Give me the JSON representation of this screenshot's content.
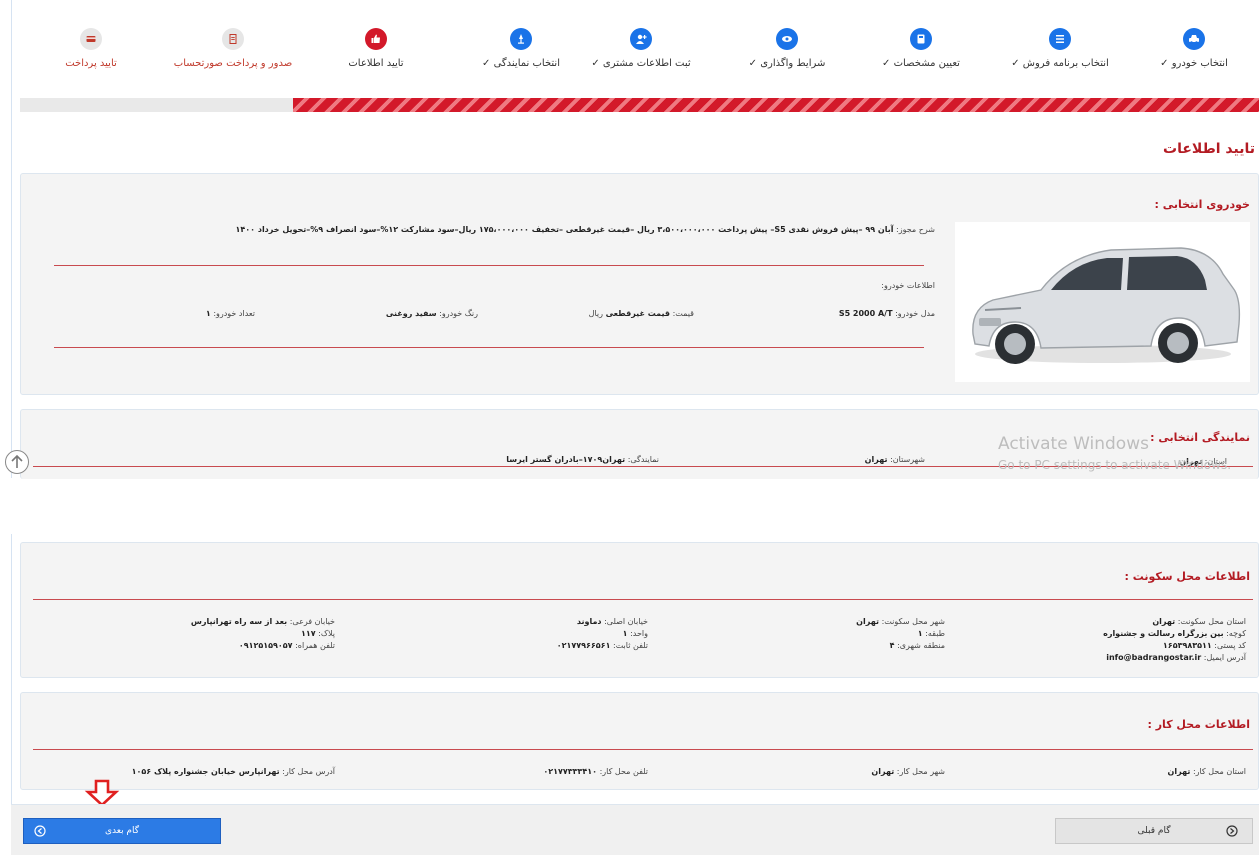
{
  "steps": [
    {
      "label": "انتخاب خودرو",
      "check": "✓",
      "state": "done",
      "icon": "car-icon"
    },
    {
      "label": "انتخاب برنامه فروش",
      "check": "✓",
      "state": "done",
      "icon": "list-icon"
    },
    {
      "label": "تعیین مشخصات",
      "check": "✓",
      "state": "done",
      "icon": "calculator-icon"
    },
    {
      "label": "شرایط واگذاری",
      "check": "✓",
      "state": "done",
      "icon": "eye-icon"
    },
    {
      "label": "ثبت اطلاعات مشتری",
      "check": "✓",
      "state": "done",
      "icon": "user-add-icon"
    },
    {
      "label": "انتخاب نمایندگی",
      "check": "✓",
      "state": "done",
      "icon": "pin-icon"
    },
    {
      "label": "تایید اطلاعات",
      "check": "",
      "state": "active",
      "icon": "thumbs-up-icon"
    },
    {
      "label": "صدور و پرداخت صورتحساب",
      "check": "",
      "state": "pending",
      "icon": "invoice-icon"
    },
    {
      "label": "تایید پرداخت",
      "check": "",
      "state": "pending",
      "icon": "card-icon"
    }
  ],
  "progress": {
    "fraction": 0.78
  },
  "page_title": "تایید اطلاعات",
  "car": {
    "title": "خودروی انتخابی :",
    "desc_label": "شرح مجوز:",
    "desc_value": "آبان ۹۹ –پیش فروش نقدی S5– پیش پرداخت ۳،۵۰۰،۰۰۰،۰۰۰ ریال –قیمت غیرقطعی –تخفیف ۱۷۵،۰۰۰،۰۰۰ ریال–سود مشارکت ۱۲%–سود انصراف ۹%–تحویل خرداد ۱۴۰۰",
    "info_label": "اطلاعات خودرو:",
    "model_label": "مدل خودرو:",
    "model_value": "S5 2000 A/T",
    "price_label": "قیمت:",
    "price_value": "قیمت غیرقطعی",
    "price_unit": "ریال",
    "color_label": "رنگ خودرو:",
    "color_value": "سفید روغنی",
    "count_label": "تعداد خودرو:",
    "count_value": "۱"
  },
  "agency": {
    "title": "نمایندگی انتخابی :",
    "province_label": "استان:",
    "province_value": "تهران",
    "city_label": "شهرستان:",
    "city_value": "تهران",
    "agency_label": "نمایندگی:",
    "agency_value": "تهران۱۷۰۹–بادران گستر ایرسا"
  },
  "residence": {
    "title": "اطلاعات محل سکونت :",
    "province_label": "استان محل سکونت:",
    "province_value": "تهران",
    "alley_label": "کوچه:",
    "alley_value": "بین بزرگراه رسالت و جشنواره",
    "postal_label": "کد پستی:",
    "postal_value": "۱۶۵۳۹۸۳۵۱۱",
    "email_label": "آدرس ایمیل:",
    "email_value": "info@badrangostar.ir",
    "city_label": "شهر محل سکونت:",
    "city_value": "تهران",
    "floor_label": "طبقه:",
    "floor_value": "۱",
    "zone_label": "منطقه شهری:",
    "zone_value": "۴",
    "main_st_label": "خیابان اصلی:",
    "main_st_value": "دماوند",
    "unit_label": "واحد:",
    "unit_value": "۱",
    "phone_label": "تلفن ثابت:",
    "phone_value": "۰۲۱۷۷۹۶۶۵۶۱",
    "sub_st_label": "خیابان فرعی:",
    "sub_st_value": "بعد از سه راه تهرانپارس",
    "plate_label": "پلاک:",
    "plate_value": "۱۱۷",
    "mobile_label": "تلفن همراه:",
    "mobile_value": "۰۹۱۲۵۱۵۹۰۵۷"
  },
  "work": {
    "title": "اطلاعات محل کار :",
    "province_label": "استان محل کار:",
    "province_value": "تهران",
    "city_label": "شهر محل کار:",
    "city_value": "تهران",
    "phone_label": "تلفن محل کار:",
    "phone_value": "۰۲۱۷۷۳۳۳۴۱۰",
    "address_label": "آدرس محل کار:",
    "address_value": "تهرانپارس خیابان جشنواره پلاک ۱۰۵۶"
  },
  "nav": {
    "next_label": "گام بعدی",
    "prev_label": "گام قبلی"
  },
  "watermark": {
    "line1": "Activate Windows",
    "line2": "Go to PC settings to activate Windows."
  },
  "colors": {
    "primary": "#1a73e8",
    "accent": "#d3192a",
    "title": "#b31b23"
  }
}
